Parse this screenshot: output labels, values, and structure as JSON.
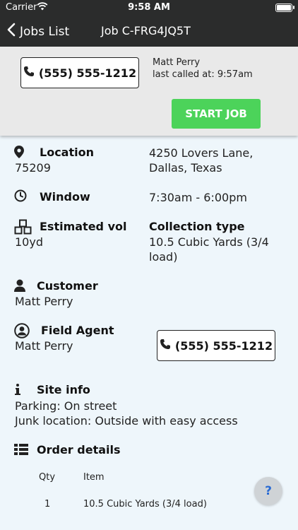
{
  "status_bar": {
    "carrier": "Carrier",
    "time": "9:58 AM"
  },
  "nav": {
    "back_label": "Jobs List",
    "title": "Job C-FRG4JQ5T"
  },
  "header": {
    "phone": "(555) 555-1212",
    "caller_name": "Matt Perry",
    "last_called": "last called at: 9:57am",
    "start_job": "START JOB"
  },
  "details": {
    "location": {
      "label": "Location",
      "zip": "75209",
      "address_line1": "4250 Lovers Lane,",
      "address_line2": "Dallas, Texas"
    },
    "window": {
      "label": "Window",
      "value": "7:30am - 6:00pm"
    },
    "estimated_vol": {
      "label": "Estimated vol",
      "value": "10yd"
    },
    "collection_type": {
      "label": "Collection type",
      "line1": "10.5 Cubic Yards (3/4",
      "line2": "load)"
    },
    "customer": {
      "label": "Customer",
      "value": "Matt Perry"
    },
    "field_agent": {
      "label": "Field Agent",
      "value": "Matt Perry",
      "phone": "(555) 555-1212"
    },
    "site_info": {
      "label": "Site info",
      "parking": "Parking: On street",
      "junk_location": "Junk location: Outside with easy access"
    }
  },
  "order": {
    "label": "Order details",
    "columns": [
      "Qty",
      "Item"
    ],
    "rows": [
      {
        "qty": "1",
        "item": "10.5 Cubic Yards (3/4 load)"
      }
    ]
  },
  "help": "?"
}
